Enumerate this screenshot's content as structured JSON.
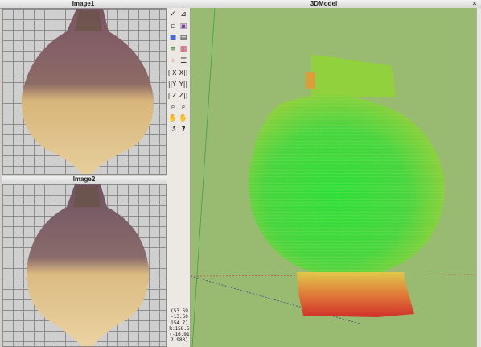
{
  "panels": {
    "image1_title": "Image1",
    "image2_title": "Image2",
    "model_title": "3DModel"
  },
  "toolbar": {
    "buttons": [
      {
        "name": "check-icon",
        "glyph": "✓"
      },
      {
        "name": "chart-icon",
        "glyph": "📈"
      },
      {
        "name": "open-icon",
        "glyph": "▫"
      },
      {
        "name": "square-icon",
        "glyph": "▣"
      },
      {
        "name": "blue-square-icon",
        "glyph": "■"
      },
      {
        "name": "save-icon",
        "glyph": "💾"
      },
      {
        "name": "layers-icon",
        "glyph": "≡"
      },
      {
        "name": "texture-icon",
        "glyph": "▦"
      },
      {
        "name": "points-icon",
        "glyph": "⁘"
      },
      {
        "name": "lines-icon",
        "glyph": "☰"
      }
    ],
    "x_left": "||X",
    "x_right": "X||",
    "y_left": "||Y",
    "y_right": "Y||",
    "z_left": "||Z",
    "z_right": "Z||",
    "rotate_label": "↺",
    "help_label": "?"
  },
  "coordinates": {
    "line1": "(53.59",
    "line2": "-13.60",
    "line3": "154.7)",
    "line4": "R:158.5",
    "line5": "(-16.91",
    "line6": "2.983)"
  },
  "colors": {
    "viewport_bg": "#98bb71",
    "turnip_top": "#6e4a5a",
    "turnip_bottom": "#e5c88e",
    "model_green": "#39d93a",
    "model_red": "#d73a2a"
  }
}
